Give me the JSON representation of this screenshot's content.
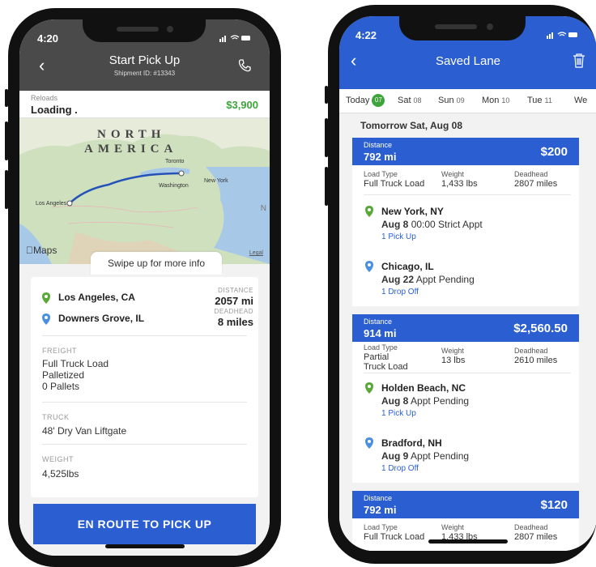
{
  "left": {
    "time": "4:20",
    "title": "Start Pick Up",
    "subtitle": "Shipment ID: #13343",
    "reload_label": "Reloads",
    "reload_status": "Loading .",
    "price": "$3,900",
    "map": {
      "region1": "NORTH",
      "region2": "AMERICA",
      "cities": [
        "Toronto",
        "Washington",
        "New York",
        "Los Angeles"
      ],
      "maps_label": "Maps",
      "legal": "Legal",
      "n_label": "N",
      "swipe_hint": "Swipe up for more info"
    },
    "origin": "Los Angeles, CA",
    "destination": "Downers Grove, IL",
    "distance_label": "DISTANCE",
    "distance_value": "2057 mi",
    "deadhead_label": "DEADHEAD",
    "deadhead_value": "8 miles",
    "freight_label": "FREIGHT",
    "freight_lines": [
      "Full Truck Load",
      "Palletized",
      "0 Pallets"
    ],
    "truck_label": "TRUCK",
    "truck_value": "48' Dry Van Liftgate",
    "weight_label": "WEIGHT",
    "weight_value": "4,525lbs",
    "button": "EN ROUTE TO PICK UP"
  },
  "right": {
    "time": "4:22",
    "title": "Saved Lane",
    "days": [
      {
        "label": "Today",
        "num": "07"
      },
      {
        "label": "Sat",
        "num": "08"
      },
      {
        "label": "Sun",
        "num": "09"
      },
      {
        "label": "Mon",
        "num": "10"
      },
      {
        "label": "Tue",
        "num": "11"
      },
      {
        "label": "We",
        "num": ""
      }
    ],
    "date_heading": "Tomorrow Sat, Aug 08",
    "lanes": [
      {
        "distance_label": "Distance",
        "distance": "792 mi",
        "price": "$200",
        "load_type_label": "Load Type",
        "load_type": "Full Truck Load",
        "weight_label": "Weight",
        "weight": "1,433 lbs",
        "deadhead_label": "Deadhead",
        "deadhead": "2807 miles",
        "pickup_city": "New York, NY",
        "pickup_date": "Aug 8",
        "pickup_appt": "00:00 Strict Appt",
        "pickup_action": "1 Pick Up",
        "drop_city": "Chicago, IL",
        "drop_date": "Aug 22",
        "drop_appt": "Appt Pending",
        "drop_action": "1 Drop Off"
      },
      {
        "distance_label": "Distance",
        "distance": "914 mi",
        "price": "$2,560.50",
        "load_type_label": "Load Type",
        "load_type_l1": "Partial",
        "load_type_l2": "Truck Load",
        "weight_label": "Weight",
        "weight": "13 lbs",
        "deadhead_label": "Deadhead",
        "deadhead": "2610 miles",
        "pickup_city": "Holden Beach, NC",
        "pickup_date": "Aug 8",
        "pickup_appt": "Appt Pending",
        "pickup_action": "1 Pick Up",
        "drop_city": "Bradford, NH",
        "drop_date": "Aug 9",
        "drop_appt": "Appt Pending",
        "drop_action": "1 Drop Off"
      },
      {
        "distance_label": "Distance",
        "distance": "792 mi",
        "price": "$120",
        "load_type_label": "Load Type",
        "load_type": "Full Truck Load",
        "weight_label": "Weight",
        "weight": "1,433 lbs",
        "deadhead_label": "Deadhead",
        "deadhead": "2807 miles"
      }
    ]
  },
  "colors": {
    "brand_blue": "#2b5fd1",
    "green": "#3da33b",
    "header_dark": "#4a4a4a",
    "pin_green": "#5aa83a",
    "pin_blue": "#4a8fe0"
  }
}
